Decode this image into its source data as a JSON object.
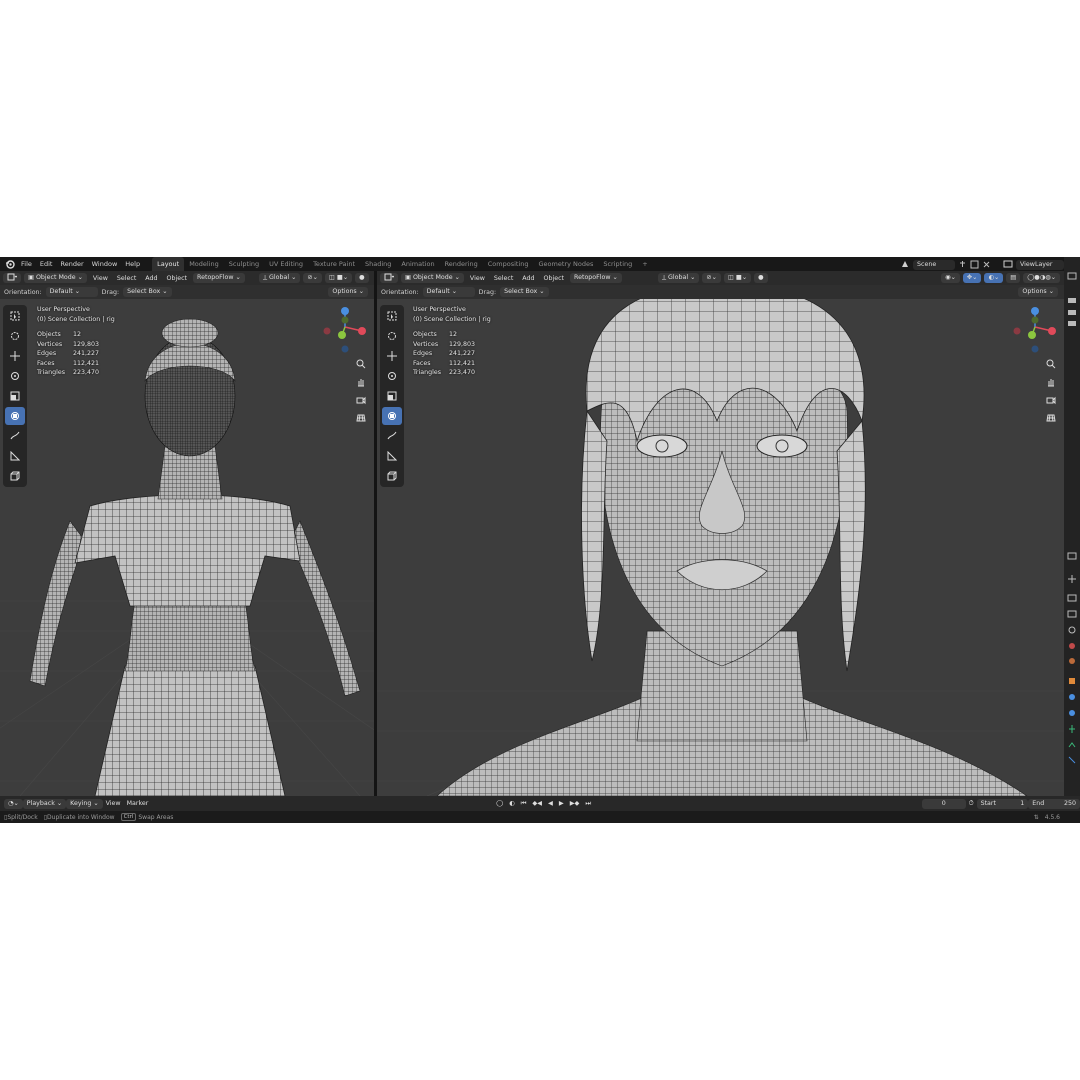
{
  "menu": [
    "File",
    "Edit",
    "Render",
    "Window",
    "Help"
  ],
  "workspaces": [
    "Layout",
    "Modeling",
    "Sculpting",
    "UV Editing",
    "Texture Paint",
    "Shading",
    "Animation",
    "Rendering",
    "Compositing",
    "Geometry Nodes",
    "Scripting"
  ],
  "workspace_add": "+",
  "scene_name": "Scene",
  "view_layer": "ViewLayer",
  "viewport_left": {
    "mode": "Object Mode",
    "menus": [
      "View",
      "Select",
      "Add",
      "Object"
    ],
    "addon": "RetopoFlow",
    "transform": "Global",
    "orientation_label": "Orientation:",
    "orientation_value": "Default",
    "drag_label": "Drag:",
    "drag_value": "Select Box",
    "options": "Options",
    "overlay_title": "User Perspective",
    "overlay_collection": "(0) Scene Collection | rig",
    "stats": [
      {
        "label": "Objects",
        "value": "12"
      },
      {
        "label": "Vertices",
        "value": "129,803"
      },
      {
        "label": "Edges",
        "value": "241,227"
      },
      {
        "label": "Faces",
        "value": "112,421"
      },
      {
        "label": "Triangles",
        "value": "223,470"
      }
    ]
  },
  "viewport_right": {
    "mode": "Object Mode",
    "menus": [
      "View",
      "Select",
      "Add",
      "Object"
    ],
    "addon": "RetopoFlow",
    "transform": "Global",
    "orientation_label": "Orientation:",
    "orientation_value": "Default",
    "drag_label": "Drag:",
    "drag_value": "Select Box",
    "options": "Options",
    "overlay_title": "User Perspective",
    "overlay_collection": "(0) Scene Collection | rig",
    "stats": [
      {
        "label": "Objects",
        "value": "12"
      },
      {
        "label": "Vertices",
        "value": "129,803"
      },
      {
        "label": "Edges",
        "value": "241,227"
      },
      {
        "label": "Faces",
        "value": "112,421"
      },
      {
        "label": "Triangles",
        "value": "223,470"
      }
    ]
  },
  "timeline": {
    "menus": [
      "Playback",
      "Keying",
      "View",
      "Marker"
    ],
    "current_frame": "0",
    "start_label": "Start",
    "start_value": "1",
    "end_label": "End",
    "end_value": "250"
  },
  "statusbar": {
    "items": [
      {
        "key": "",
        "text": "Split/Dock"
      },
      {
        "key": "",
        "text": "Duplicate into Window"
      },
      {
        "key": "Ctrl",
        "text": "Swap Areas"
      }
    ],
    "version": "4.5.6"
  },
  "colors": {
    "accent": "#4772b3",
    "axis_x": "#e04a5a",
    "axis_y": "#8cc63f",
    "axis_z": "#4a8fe0",
    "viewport_bg": "#3d3d3d",
    "mesh": "#b9b9b9"
  }
}
